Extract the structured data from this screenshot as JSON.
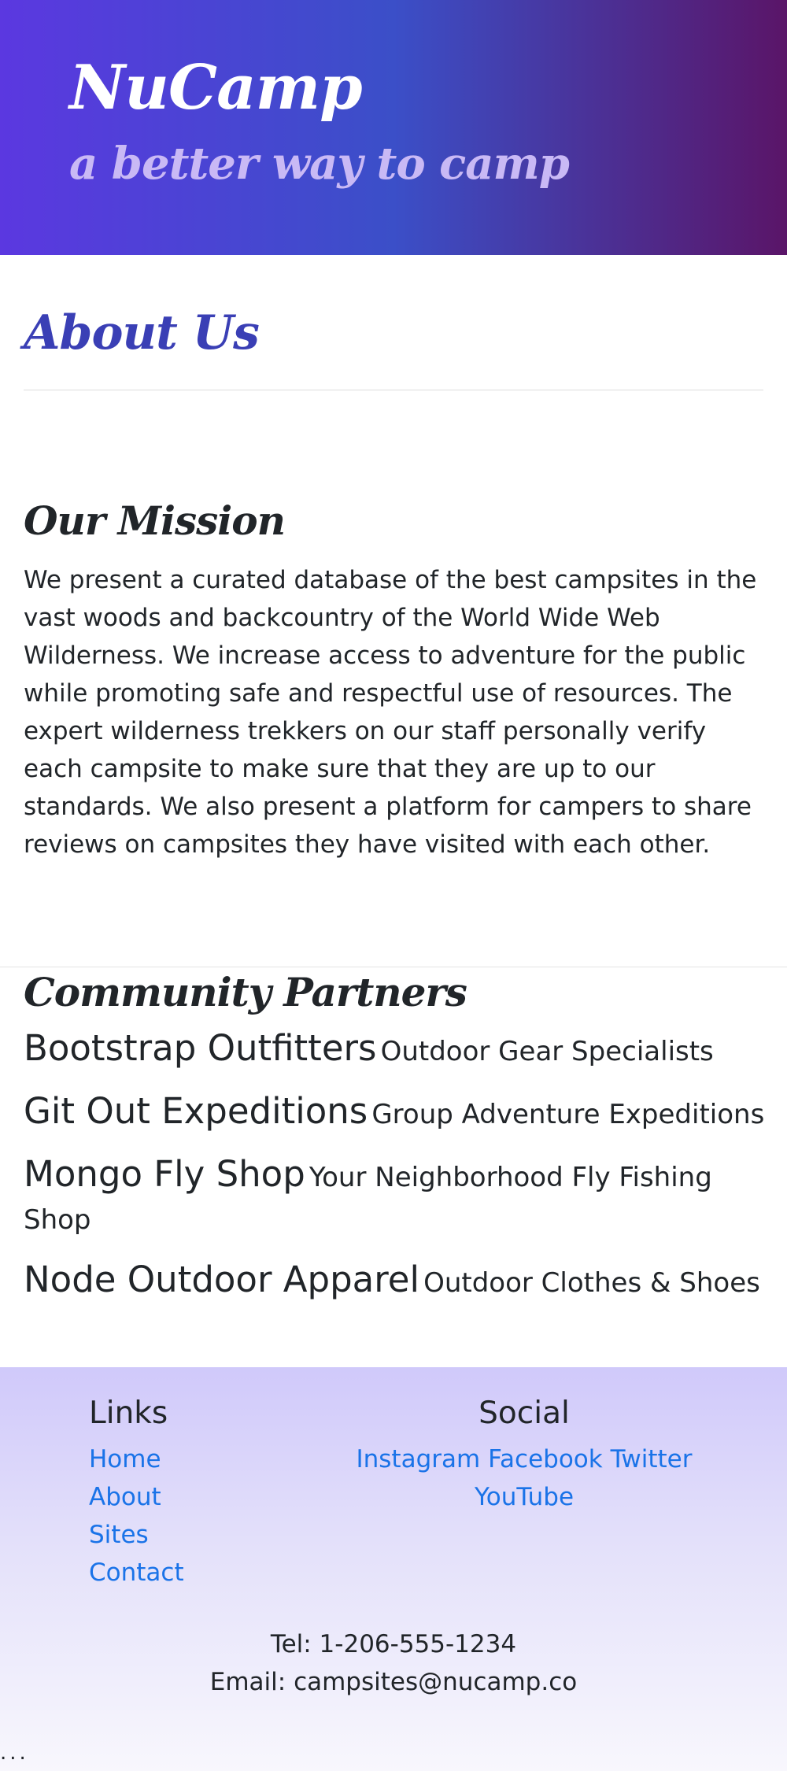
{
  "header": {
    "brand": "NuCamp",
    "tagline": "a better way to camp"
  },
  "page": {
    "title": "About Us"
  },
  "mission": {
    "heading": "Our Mission",
    "text": "We present a curated database of the best campsites in the vast woods and backcountry of the World Wide Web Wilderness. We increase access to adventure for the public while promoting safe and respectful use of resources. The expert wilderness trekkers on our staff personally verify each campsite to make sure that they are up to our standards. We also present a platform for campers to share reviews on campsites they have visited with each other."
  },
  "partners": {
    "heading": "Community Partners",
    "items": [
      {
        "name": "Bootstrap Outfitters",
        "description": "Outdoor Gear Specialists"
      },
      {
        "name": "Git Out Expeditions",
        "description": "Group Adventure Expeditions"
      },
      {
        "name": "Mongo Fly Shop",
        "description": "Your Neighborhood Fly Fishing Shop"
      },
      {
        "name": "Node Outdoor Apparel",
        "description": "Outdoor Clothes & Shoes"
      }
    ]
  },
  "footer": {
    "links_heading": "Links",
    "links": [
      "Home",
      "About",
      "Sites",
      "Contact"
    ],
    "social_heading": "Social",
    "social": [
      "Instagram",
      "Facebook",
      "Twitter",
      "YouTube"
    ],
    "tel": "Tel: 1-206-555-1234",
    "email": "Email: campsites@nucamp.co",
    "ellipsis": "..."
  },
  "colors": {
    "header_gradient_start": "#5b38e0",
    "header_gradient_mid": "#3b4fc8",
    "header_gradient_end": "#5a1568",
    "title_accent": "#3a3fb5",
    "link": "#1a73e8",
    "footer_bg": "#d0c9fa"
  }
}
